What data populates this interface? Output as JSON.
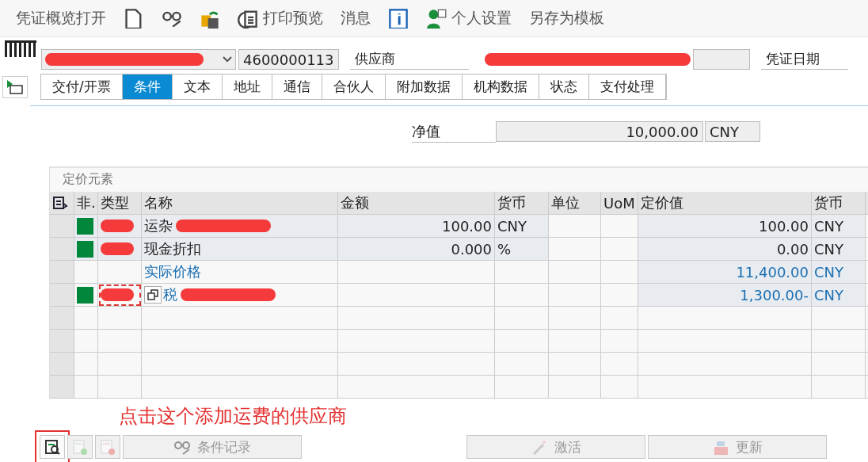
{
  "toolbar": [
    {
      "kind": "text",
      "label": "凭证概览打开"
    },
    {
      "kind": "icon"
    },
    {
      "kind": "icon"
    },
    {
      "kind": "icon"
    },
    {
      "kind": "labeled",
      "label": "打印预览"
    },
    {
      "kind": "text",
      "label": "消息"
    },
    {
      "kind": "icon"
    },
    {
      "kind": "labeled",
      "label": "个人设置"
    },
    {
      "kind": "text",
      "label": "另存为模板"
    }
  ],
  "header": {
    "document_number": "4600000113",
    "vendor_label": "供应商",
    "date_label": "凭证日期"
  },
  "tabs": [
    {
      "label": "交付/开票",
      "selected": false
    },
    {
      "label": "条件",
      "selected": true
    },
    {
      "label": "文本",
      "selected": false
    },
    {
      "label": "地址",
      "selected": false
    },
    {
      "label": "通信",
      "selected": false
    },
    {
      "label": "合伙人",
      "selected": false
    },
    {
      "label": "附加数据",
      "selected": false
    },
    {
      "label": "机构数据",
      "selected": false
    },
    {
      "label": "状态",
      "selected": false
    },
    {
      "label": "支付处理",
      "selected": false
    }
  ],
  "net_value": {
    "label": "净值",
    "value": "10,000.00",
    "currency": "CNY"
  },
  "pricing": {
    "title": "定价元素",
    "columns": [
      "非.",
      "类型",
      "名称",
      "金额",
      "货币",
      "单位",
      "UoM",
      "定价值",
      "货币"
    ],
    "rows": [
      {
        "kind": "item",
        "active": true,
        "type_redacted": true,
        "focused": false,
        "name": "运杂",
        "name_redacted": true,
        "amount": "100.00",
        "currency": "CNY",
        "value": "100.00",
        "value_currency": "CNY"
      },
      {
        "kind": "item",
        "active": true,
        "type_redacted": true,
        "focused": false,
        "name": "现金折扣",
        "name_redacted": false,
        "amount": "0.000",
        "currency": "%",
        "value": "0.00",
        "value_currency": "CNY"
      },
      {
        "kind": "subtotal",
        "active": false,
        "type_redacted": false,
        "focused": false,
        "name": "实际价格",
        "name_redacted": false,
        "value": "11,400.00",
        "value_currency": "CNY"
      },
      {
        "kind": "subtotal",
        "active": true,
        "type_redacted": true,
        "focused": true,
        "name": "税",
        "name_redacted": true,
        "value": "1,300.00-",
        "value_currency": "CNY"
      }
    ]
  },
  "annotation": "点击这个添加运费的供应商",
  "buttons": [
    {
      "kind": "icon",
      "disabled": false,
      "highlighted": true
    },
    {
      "kind": "icon",
      "disabled": true,
      "highlighted": false
    },
    {
      "kind": "icon",
      "disabled": true,
      "highlighted": false
    },
    {
      "kind": "wide",
      "label": "条件记录",
      "disabled": true,
      "highlighted": false
    },
    {
      "kind": "spacer"
    },
    {
      "kind": "wide",
      "label": "激活",
      "disabled": true,
      "highlighted": false
    },
    {
      "kind": "wide",
      "label": "更新",
      "disabled": true,
      "highlighted": false
    }
  ]
}
